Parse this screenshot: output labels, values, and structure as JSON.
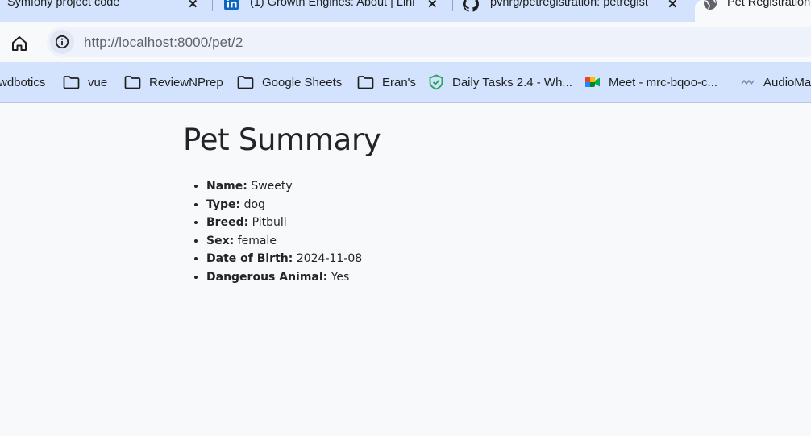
{
  "tabs": [
    {
      "title": "Symfony project code",
      "favicon": "none"
    },
    {
      "title": "(1) Growth Engines: About | Linl",
      "favicon": "linkedin-icon"
    },
    {
      "title": "pvhrg/petregistration: petregist",
      "favicon": "github-icon"
    },
    {
      "title": "Pet Registration",
      "favicon": "globe-icon",
      "active": true
    }
  ],
  "address_bar": {
    "url_host": "http://localhost",
    "url_path": ":8000/pet/2"
  },
  "bookmarks": [
    {
      "label": "wdbotics",
      "icon": "none"
    },
    {
      "label": "vue",
      "icon": "folder-icon"
    },
    {
      "label": "ReviewNPrep",
      "icon": "folder-icon"
    },
    {
      "label": "Google Sheets",
      "icon": "folder-icon"
    },
    {
      "label": "Eran's",
      "icon": "folder-icon"
    },
    {
      "label": "Daily Tasks 2.4 - Wh...",
      "icon": "check-shield-icon"
    },
    {
      "label": "Meet - mrc-bqoo-c...",
      "icon": "meet-icon"
    },
    {
      "label": "AudioMa",
      "icon": "waveform-icon"
    }
  ],
  "page": {
    "heading": "Pet Summary",
    "fields": [
      {
        "label": "Name:",
        "value": "Sweety"
      },
      {
        "label": "Type:",
        "value": "dog"
      },
      {
        "label": "Breed:",
        "value": "Pitbull"
      },
      {
        "label": "Sex:",
        "value": "female"
      },
      {
        "label": "Date of Birth:",
        "value": "2024-11-08"
      },
      {
        "label": "Dangerous Animal:",
        "value": "Yes"
      }
    ]
  },
  "colors": {
    "chrome_frame": "#d3e3fd",
    "page_background": "#f8f9fb",
    "text": "#212529"
  }
}
